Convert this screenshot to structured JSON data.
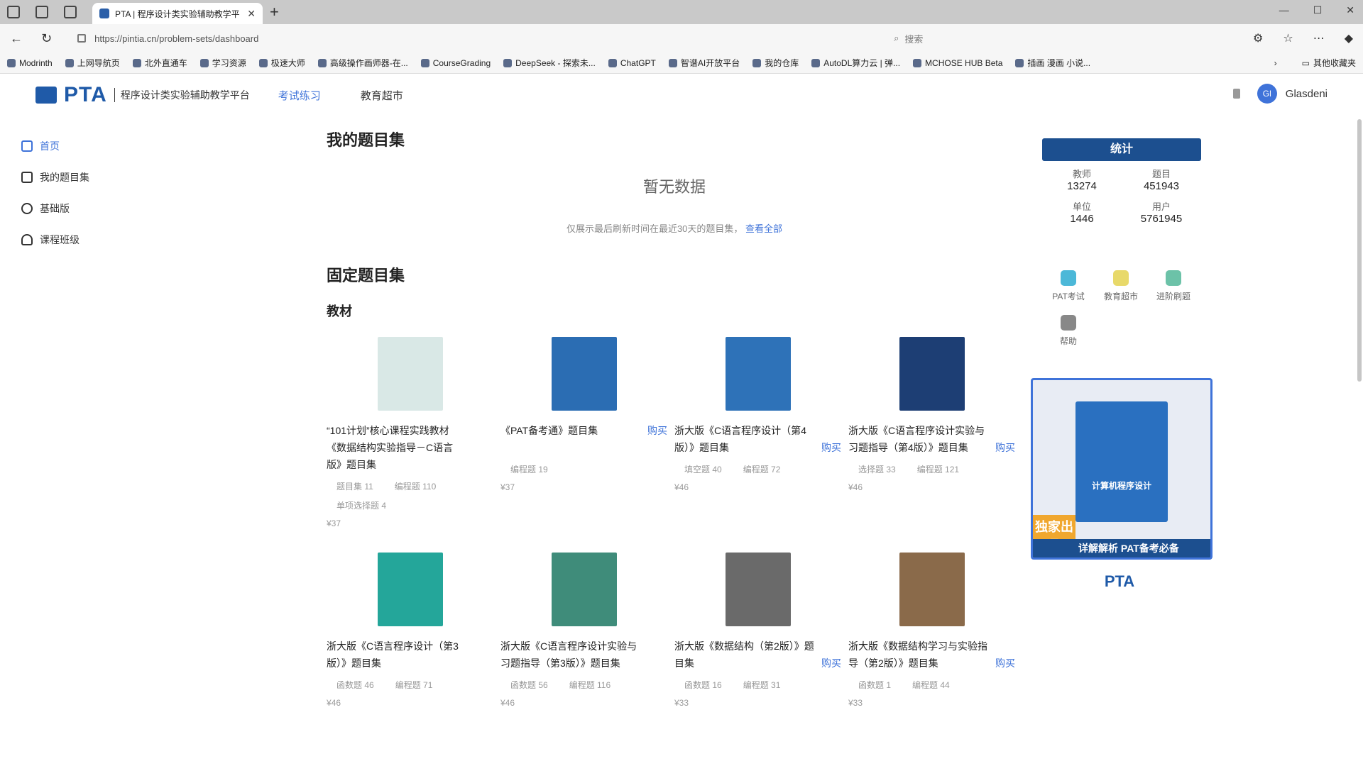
{
  "browser": {
    "tab_title": "PTA | 程序设计类实验辅助教学平",
    "url": "https://pintia.cn/problem-sets/dashboard",
    "search_placeholder": "搜索",
    "bookmarks": [
      "Modrinth",
      "上网导航页",
      "北外直通车",
      "学习资源",
      "极速大师",
      "高级操作画师器-在...",
      "CourseGrading",
      "DeepSeek - 探索未...",
      "ChatGPT",
      "智谱AI开放平台",
      "我的仓库",
      "AutoDL算力云 | 弹...",
      "MCHOSE HUB Beta",
      "插画 漫画 小说..."
    ],
    "bookmarks_folder": "其他收藏夹"
  },
  "header": {
    "logo": "PTA",
    "logo_sub": "程序设计类实验辅助教学平台",
    "nav": [
      "考试练习",
      "教育超市"
    ],
    "user_initials": "Gl",
    "username": "Glasdeni"
  },
  "sidebar": {
    "items": [
      {
        "label": "首页",
        "icon": "home-icon"
      },
      {
        "label": "我的题目集",
        "icon": "book-icon"
      },
      {
        "label": "基础版",
        "icon": "clock-icon"
      },
      {
        "label": "课程班级",
        "icon": "users-icon"
      }
    ]
  },
  "main": {
    "my_sets_title": "我的题目集",
    "empty_text": "暂无数据",
    "empty_hint": "仅展示最后刷新时间在最近30天的题目集",
    "view_all": "查看全部",
    "fixed_title": "固定题目集",
    "textbook_title": "教材",
    "books": [
      {
        "title": "“101计划”核心课程实践教材《数据结构实验指导－C语言版》题目集",
        "buy": "",
        "meta1": "题目集 11",
        "meta2": "编程题 110",
        "meta3": "单项选择题 4",
        "price": "¥37",
        "cover": "#d9e8e6"
      },
      {
        "title": "《PAT备考通》题目集",
        "buy": "购买",
        "meta1": "编程题 19",
        "meta2": "",
        "meta3": "",
        "price": "¥37",
        "cover": "#2b6db3"
      },
      {
        "title": "浙大版《C语言程序设计（第4版）》题目集",
        "buy": "购买",
        "meta1": "填空题 40",
        "meta2": "编程题 72",
        "meta3": "",
        "price": "¥46",
        "cover": "#2e72b8"
      },
      {
        "title": "浙大版《C语言程序设计实验与习题指导（第4版）》题目集",
        "buy": "购买",
        "meta1": "选择题 33",
        "meta2": "编程题 121",
        "meta3": "",
        "price": "¥46",
        "cover": "#1d3e74"
      },
      {
        "title": "浙大版《C语言程序设计（第3版）》题目集",
        "buy": "",
        "meta1": "函数题 46",
        "meta2": "编程题 71",
        "meta3": "",
        "price": "¥46",
        "cover": "#24a69a"
      },
      {
        "title": "浙大版《C语言程序设计实验与习题指导（第3版）》题目集",
        "buy": "",
        "meta1": "函数题 56",
        "meta2": "编程题 116",
        "meta3": "",
        "price": "¥46",
        "cover": "#3f8c7a"
      },
      {
        "title": "浙大版《数据结构（第2版）》题目集",
        "buy": "购买",
        "meta1": "函数题 16",
        "meta2": "编程题 31",
        "meta3": "",
        "price": "¥33",
        "cover": "#6a6a6a"
      },
      {
        "title": "浙大版《数据结构学习与实验指导（第2版）》题目集",
        "buy": "购买",
        "meta1": "函数题 1",
        "meta2": "编程题 44",
        "meta3": "",
        "price": "¥33",
        "cover": "#8a6a4a"
      }
    ]
  },
  "right_panel": {
    "stat_header": "统计",
    "stats": [
      {
        "label": "教师",
        "value": "13274"
      },
      {
        "label": "题目",
        "value": "451943"
      },
      {
        "label": "单位",
        "value": "1446"
      },
      {
        "label": "用户",
        "value": "5761945"
      }
    ],
    "quick_links": [
      {
        "label": "PAT考试",
        "color": "#4cb8d8"
      },
      {
        "label": "教育超市",
        "color": "#e8d96a"
      },
      {
        "label": "进阶刷题",
        "color": "#6cc2a8"
      },
      {
        "label": "帮助",
        "color": "#888888"
      }
    ],
    "promo_top": "",
    "promo_book_title": "计算机程序设计",
    "promo_bar": "详解解析 PAT备考必备",
    "promo_badge": "独家出品",
    "footer_brand": "PTA",
    "footer_lines": [
      "",
      "",
      ""
    ]
  }
}
